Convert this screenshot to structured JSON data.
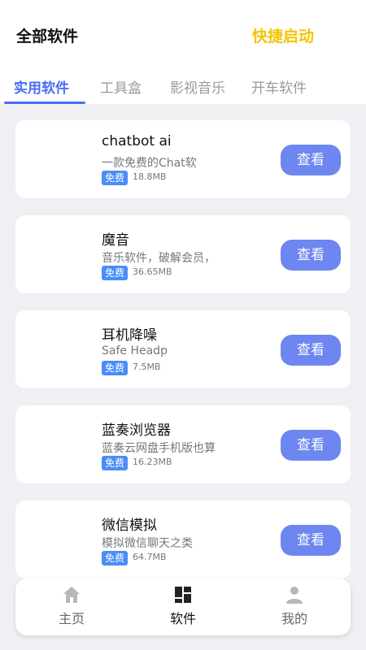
{
  "header": {
    "title": "全部软件",
    "quick_start": "快捷启动"
  },
  "tabs": [
    {
      "label": "实用软件",
      "active": true
    },
    {
      "label": "工具盒",
      "active": false
    },
    {
      "label": "影视音乐",
      "active": false
    },
    {
      "label": "开车软件",
      "active": false
    }
  ],
  "apps": [
    {
      "name": "chatbot ai",
      "desc": "一款免费的Chat软",
      "badge": "免费",
      "size": "18.8MB",
      "button": "查看"
    },
    {
      "name": "魔音",
      "desc": "音乐软件，破解会员，",
      "badge": "免费",
      "size": "36.65MB",
      "button": "查看"
    },
    {
      "name": "耳机降噪",
      "desc": "Safe Headp",
      "badge": "免费",
      "size": "7.5MB",
      "button": "查看"
    },
    {
      "name": "蓝奏浏览器",
      "desc": "蓝奏云网盘手机版也算",
      "badge": "免费",
      "size": "16.23MB",
      "button": "查看"
    },
    {
      "name": "微信模拟",
      "desc": "模拟微信聊天之类",
      "badge": "免费",
      "size": "64.7MB",
      "button": "查看"
    }
  ],
  "bottom_nav": [
    {
      "label": "主页",
      "icon": "home-icon",
      "active": false
    },
    {
      "label": "软件",
      "icon": "apps-icon",
      "active": true
    },
    {
      "label": "我的",
      "icon": "user-icon",
      "active": false
    }
  ],
  "colors": {
    "accent": "#4a6cf7",
    "quick_start": "#f5c400",
    "button": "#6d86f0",
    "badge": "#4a8df8",
    "background": "#f0eff4"
  }
}
